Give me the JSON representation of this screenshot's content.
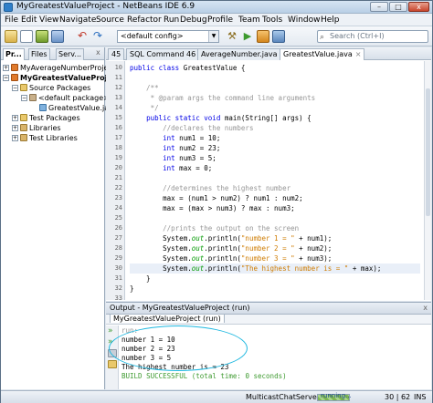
{
  "window": {
    "title": "MyGreatestValueProject - NetBeans IDE 6.9",
    "controls": {
      "minimize": "–",
      "maximize": "□",
      "close": "x"
    }
  },
  "menu": [
    "File",
    "Edit",
    "View",
    "Navigate",
    "Source",
    "Refactor",
    "Run",
    "Debug",
    "Profile",
    "Team",
    "Tools",
    "Window",
    "Help"
  ],
  "toolbar": {
    "config": "<default config>",
    "search_placeholder": "Search (Ctrl+I)"
  },
  "left_panel": {
    "tabs": [
      "Pr...",
      "Files",
      "Serv..."
    ],
    "close": "x",
    "tree": [
      {
        "label": "MyAverageNumberProject",
        "bold": false
      },
      {
        "label": "MyGreatestValueProject",
        "bold": true
      },
      {
        "label": "Source Packages",
        "bold": false
      },
      {
        "label": "<default package>",
        "bold": false
      },
      {
        "label": "GreatestValue.java",
        "bold": false
      },
      {
        "label": "Test Packages",
        "bold": false
      },
      {
        "label": "Libraries",
        "bold": false
      },
      {
        "label": "Test Libraries",
        "bold": false
      }
    ]
  },
  "editor": {
    "tabs": [
      "45",
      "SQL Command 46",
      "AverageNumber.java",
      "GreatestValue.java"
    ],
    "active_tab": "GreatestValue.java",
    "line_numbers": [
      "10",
      "11",
      "12",
      "13",
      "14",
      "15",
      "16",
      "17",
      "18",
      "19",
      "20",
      "21",
      "22",
      "23",
      "24",
      "25",
      "26",
      "27",
      "28",
      "29",
      "30",
      "31",
      "32",
      "33"
    ],
    "code": [
      "public class GreatestValue {",
      "",
      "    /**",
      "     * @param args the command line arguments",
      "     */",
      "    public static void main(String[] args) {",
      "        //declares the numbers",
      "        int num1 = 10;",
      "        int num2 = 23;",
      "        int num3 = 5;",
      "        int max = 0;",
      "",
      "        //determines the highest number",
      "        max = (num1 > num2) ? num1 : num2;",
      "        max = (max > num3) ? max : num3;",
      "",
      "        //prints the output on the screen",
      "        System.out.println(\"number 1 = \" + num1);",
      "        System.out.println(\"number 2 = \" + num2);",
      "        System.out.println(\"number 3 = \" + num3);",
      "        System.out.println(\"The highest number is = \" + max);",
      "    }",
      "}",
      ""
    ]
  },
  "output": {
    "title": "Output - MyGreatestValueProject (run)",
    "close": "x",
    "tab": "MyGreatestValueProject (run)",
    "lines": [
      "run:",
      "number 1 = 10",
      "number 2 = 23",
      "number 3 = 5",
      "The highest number is = 23",
      "BUILD SUCCESSFUL (total time: 0 seconds)"
    ]
  },
  "statusbar": {
    "project": "MulticastChatServer (run)",
    "progress_label": "running...",
    "position": "30 | 62",
    "mode": "INS"
  },
  "colors": {
    "keyword": "#0000e6",
    "comment": "#969696",
    "string": "#ce7b00",
    "annotation_circle": "#1fb8e0"
  }
}
